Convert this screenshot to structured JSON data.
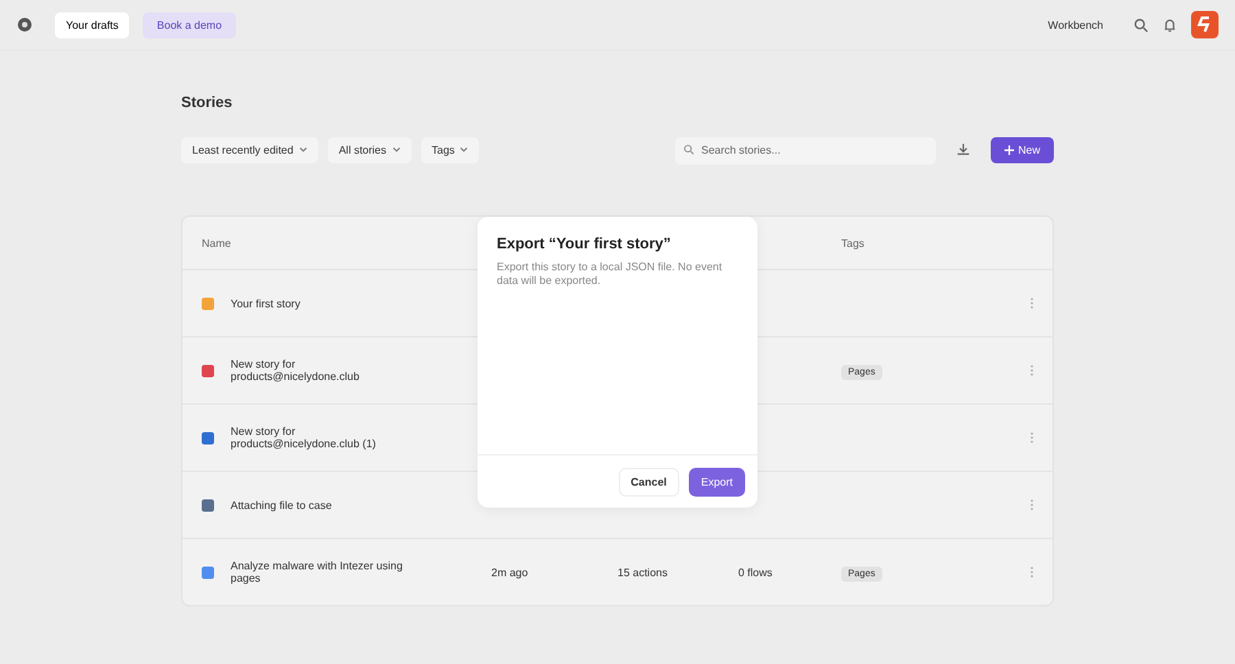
{
  "topbar": {
    "workspace": "Your drafts",
    "demo_button": "Book a demo",
    "workbench_button": "Workbench"
  },
  "page": {
    "title": "Stories",
    "filters": [
      "Least recently edited",
      "All stories",
      "Tags"
    ],
    "search": {
      "placeholder": "Search stories..."
    },
    "new_button": "New"
  },
  "table": {
    "columns": [
      "Name",
      "",
      "",
      "",
      "Tags"
    ],
    "rows": [
      {
        "name": "Your first story",
        "color": "#f2a33a",
        "cells": [
          "",
          "",
          ""
        ],
        "tag": ""
      },
      {
        "name": "New story for products@nicelydone.club",
        "color": "#e0454f",
        "cells": [
          "",
          "",
          ""
        ],
        "tag": "Pages"
      },
      {
        "name": "New story for products@nicelydone.club (1)",
        "color": "#2f6fd1",
        "cells": [
          "",
          "",
          ""
        ],
        "tag": ""
      },
      {
        "name": "Attaching file to case",
        "color": "#5a6f8f",
        "cells": [
          "",
          "",
          ""
        ],
        "tag": ""
      },
      {
        "name": "Analyze malware with Intezer using pages",
        "color": "#4f8ef0",
        "cells": [
          "2m ago",
          "15 actions",
          "0 flows"
        ],
        "tag": "Pages"
      }
    ]
  },
  "dialog": {
    "title": "Export “Your first story”",
    "description": "Export this story to a local JSON file. No event data will be exported.",
    "buttons": [
      {
        "label": "Cancel",
        "kind": "secondary"
      },
      {
        "label": "Export",
        "kind": "primary"
      }
    ]
  }
}
